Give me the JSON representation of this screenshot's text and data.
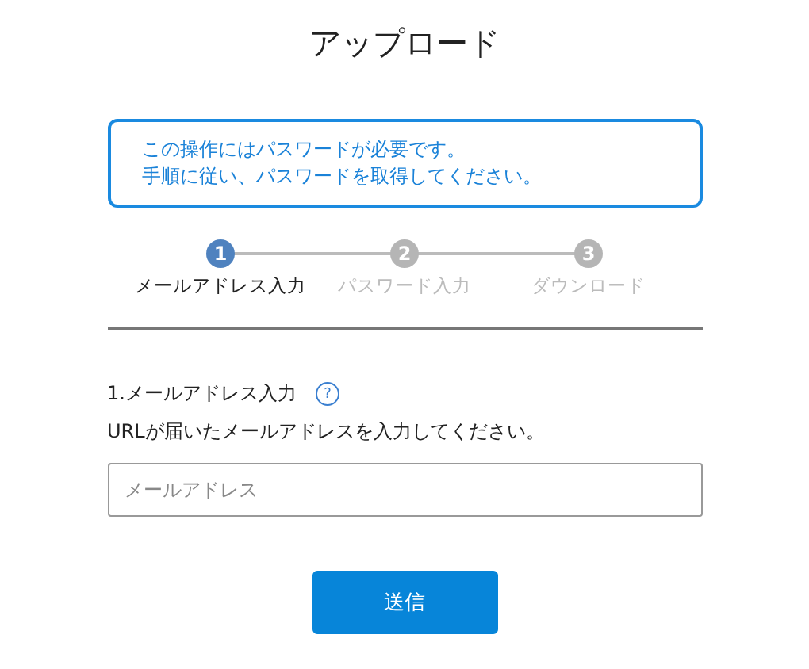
{
  "title": "アップロード",
  "notice": [
    "この操作にはパスワードが必要です。",
    "手順に従い、パスワードを取得してください。"
  ],
  "steps": [
    {
      "number": "1",
      "label": "メールアドレス入力",
      "active": true
    },
    {
      "number": "2",
      "label": "パスワード入力",
      "active": false
    },
    {
      "number": "3",
      "label": "ダウンロード",
      "active": false
    }
  ],
  "section": {
    "heading": "1.メールアドレス入力",
    "help": "?",
    "description": "URLが届いたメールアドレスを入力してください。"
  },
  "email_field": {
    "placeholder": "メールアドレス"
  },
  "submit_button": "送信"
}
